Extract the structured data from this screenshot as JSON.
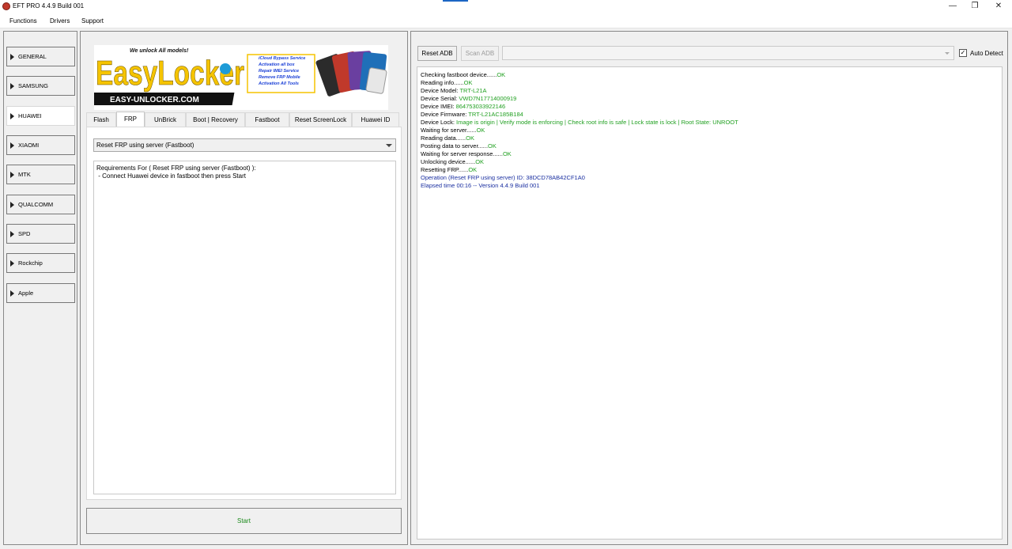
{
  "window": {
    "title": "EFT PRO 4.4.9 Build 001"
  },
  "menu": [
    "Functions",
    "Drivers",
    "Support"
  ],
  "categories": [
    "GENERAL",
    "SAMSUNG",
    "HUAWEI",
    "XIAOMI",
    "MTK",
    "QUALCOMM",
    "SPD",
    "Rockchip",
    "Apple"
  ],
  "active_category": "HUAWEI",
  "banner": {
    "logo_text": "EasyLocker",
    "tagline": "We unlock All models!",
    "url": "EASY-UNLOCKER.COM",
    "services": [
      "iCloud Bypass Service",
      "Activation all box",
      "Repair IMEI Service",
      "Remove FRP Mobile",
      "Activation All Tools"
    ]
  },
  "tabs": [
    "Flash",
    "FRP",
    "UnBrick",
    "Boot | Recovery",
    "Fastboot",
    "Reset ScreenLock",
    "Huawei ID"
  ],
  "active_tab": "FRP",
  "operation_select": "Reset FRP using server (Fastboot)",
  "requirements": {
    "title": "Requirements For ( Reset FRP using server (Fastboot) ):",
    "line": " - Connect Huawei device in fastboot then press Start"
  },
  "start_label": "Start",
  "right_toolbar": {
    "reset_adb": "Reset ADB",
    "scan_adb": "Scan ADB",
    "device_combo": "",
    "auto_detect_label": "Auto Detect",
    "auto_detect_checked": true
  },
  "log": {
    "checking_fastboot": "Checking fastboot device......",
    "reading_info": "Reading info......",
    "device_model_label": "Device Model: ",
    "device_model": "TRT-L21A",
    "device_serial_label": "Device Serial: ",
    "device_serial": "VWD7N17714000919",
    "device_imei_label": "Device IMEI: ",
    "device_imei": "864753033922146",
    "device_firmware_label": "Device Firmware: ",
    "device_firmware": "TRT-L21AC185B184",
    "device_lock_label": "Device Lock: ",
    "device_lock": "Image is origin | Verify mode is enforcing | Check root info is safe | Lock state is lock | Root State: UNROOT",
    "waiting_server": "Waiting for server......",
    "reading_data": "Reading data......",
    "posting_data": "Posting data to server......",
    "waiting_response": "Waiting for server response......",
    "unlocking": "Unlocking device......",
    "resetting_frp": "Resetting FRP......",
    "ok": "OK",
    "operation": "Operation (Reset FRP using server) ID: 38DCD78AB42CF1A0",
    "elapsed": "Elapsed time 00:16 -- Version 4.4.9 Build 001"
  },
  "colors": {
    "ok_green": "#21a021",
    "info_blue": "#1a2fa0",
    "start_green": "#1a8a1a",
    "logo_yellow": "#f5c400"
  }
}
